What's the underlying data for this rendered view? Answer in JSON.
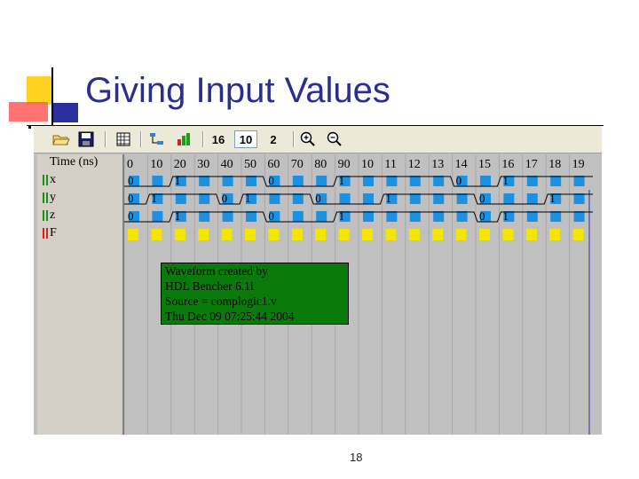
{
  "slide": {
    "title": "Giving Input Values",
    "page_number": "18"
  },
  "toolbar": {
    "zoom_a": "16",
    "zoom_b": "10",
    "zoom_c": "2",
    "icons": [
      "open-folder-icon",
      "save-icon",
      "grid-icon",
      "hierarchy-icon",
      "bar-chart-icon",
      "zoom-in-icon",
      "zoom-out-icon"
    ]
  },
  "signals": {
    "time_label": "Time (ns)",
    "rows": [
      {
        "name": "x",
        "type": "input",
        "bar_color": "#1a8f1a"
      },
      {
        "name": "y",
        "type": "input",
        "bar_color": "#1a8f1a"
      },
      {
        "name": "z",
        "type": "input",
        "bar_color": "#1a8f1a"
      },
      {
        "name": "F",
        "type": "output",
        "bar_color": "#d42020"
      }
    ]
  },
  "timeline": {
    "ticks": [
      "0",
      "10",
      "20",
      "30",
      "40",
      "50",
      "60",
      "70",
      "80",
      "90",
      "10",
      "11",
      "12",
      "13",
      "14",
      "15",
      "16",
      "17",
      "18",
      "19"
    ]
  },
  "waveforms": {
    "x": {
      "values": [
        "0",
        "0",
        "1",
        "1",
        "1",
        "1",
        "0",
        "0",
        "0",
        "1",
        "1",
        "1",
        "1",
        "1",
        "0",
        "0",
        "1",
        "1",
        "1",
        "1"
      ]
    },
    "y": {
      "values": [
        "0",
        "1",
        "1",
        "1",
        "0",
        "1",
        "1",
        "1",
        "0",
        "0",
        "0",
        "1",
        "1",
        "1",
        "1",
        "0",
        "0",
        "0",
        "1",
        "1"
      ]
    },
    "z": {
      "values": [
        "0",
        "0",
        "1",
        "1",
        "1",
        "1",
        "0",
        "0",
        "0",
        "1",
        "1",
        "1",
        "1",
        "1",
        "1",
        "0",
        "1",
        "1",
        "1",
        "1"
      ]
    }
  },
  "info_box": {
    "lines": [
      "Waveform created by",
      "HDL Bencher 6.1i",
      "Source = complogic1.v",
      "Thu Dec 09 07:25:44 2004"
    ]
  },
  "colors": {
    "title": "#2b2f8c",
    "input_cell": "#1e90e0",
    "output_cell": "#f5e600",
    "wave_bg": "#c0c0c0",
    "info_bg": "#0a7a0a",
    "cursor": "#3030a0"
  }
}
